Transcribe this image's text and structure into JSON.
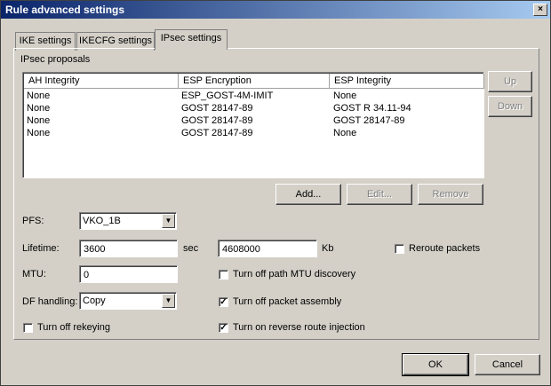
{
  "window": {
    "title": "Rule advanced settings",
    "close": "×"
  },
  "tabs": [
    {
      "label": "IKE settings"
    },
    {
      "label": "IKECFG settings"
    },
    {
      "label": "IPsec settings"
    }
  ],
  "proposals": {
    "group_label": "IPsec proposals",
    "columns": [
      "AH Integrity",
      "ESP Encryption",
      "ESP Integrity"
    ],
    "rows": [
      [
        "None",
        "ESP_GOST-4M-IMIT",
        "None"
      ],
      [
        "None",
        "GOST 28147-89",
        "GOST R 34.11-94"
      ],
      [
        "None",
        "GOST 28147-89",
        "GOST 28147-89"
      ],
      [
        "None",
        "GOST 28147-89",
        "None"
      ]
    ],
    "up_label": "Up",
    "down_label": "Down",
    "add_label": "Add...",
    "edit_label": "Edit...",
    "remove_label": "Remove"
  },
  "form": {
    "pfs_label": "PFS:",
    "pfs_value": "VKO_1B",
    "lifetime_label": "Lifetime:",
    "lifetime_sec": "3600",
    "sec_unit": "sec",
    "lifetime_kb": "4608000",
    "kb_unit": "Kb",
    "reroute_label": "Reroute packets",
    "reroute_checked": false,
    "mtu_label": "MTU:",
    "mtu_value": "0",
    "path_mtu_label": "Turn off path MTU discovery",
    "path_mtu_checked": false,
    "df_label": "DF handling:",
    "df_value": "Copy",
    "packet_assembly_label": "Turn off packet assembly",
    "packet_assembly_checked": true,
    "rekeying_label": "Turn off rekeying",
    "rekeying_checked": false,
    "reverse_route_label": "Turn on reverse route injection",
    "reverse_route_checked": true
  },
  "footer": {
    "ok_label": "OK",
    "cancel_label": "Cancel"
  },
  "check_mark": "✓"
}
